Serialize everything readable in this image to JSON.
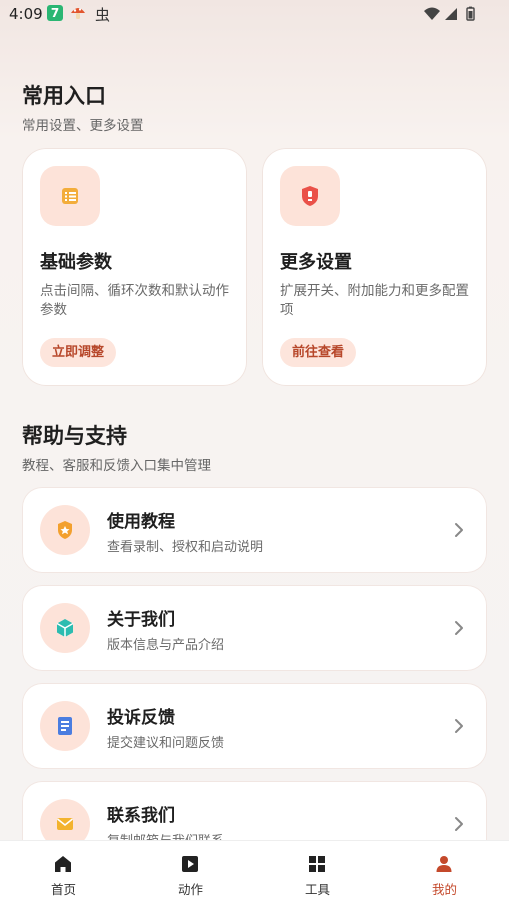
{
  "status": {
    "time": "4:09",
    "green_badge": "7",
    "bug_glyph": "虫"
  },
  "section1": {
    "title": "常用入口",
    "subtitle": "常用设置、更多设置",
    "cards": [
      {
        "title": "基础参数",
        "desc": "点击间隔、循环次数和默认动作参数",
        "action": "立即调整",
        "icon": "list-icon"
      },
      {
        "title": "更多设置",
        "desc": "扩展开关、附加能力和更多配置项",
        "action": "前往查看",
        "icon": "shield-icon"
      }
    ]
  },
  "section2": {
    "title": "帮助与支持",
    "subtitle": "教程、客服和反馈入口集中管理",
    "items": [
      {
        "title": "使用教程",
        "desc": "查看录制、授权和启动说明",
        "icon": "shield-star-icon"
      },
      {
        "title": "关于我们",
        "desc": "版本信息与产品介绍",
        "icon": "cube-icon"
      },
      {
        "title": "投诉反馈",
        "desc": "提交建议和问题反馈",
        "icon": "document-icon"
      },
      {
        "title": "联系我们",
        "desc": "复制邮箱与我们联系",
        "icon": "mail-icon"
      }
    ]
  },
  "nav": [
    {
      "label": "首页",
      "icon": "home-icon"
    },
    {
      "label": "动作",
      "icon": "play-icon"
    },
    {
      "label": "工具",
      "icon": "grid-icon"
    },
    {
      "label": "我的",
      "icon": "person-icon",
      "active": true
    }
  ],
  "colors": {
    "accent": "#c4492b",
    "pill_bg": "#fde5dc",
    "icon_bg": "#fde3d9"
  }
}
